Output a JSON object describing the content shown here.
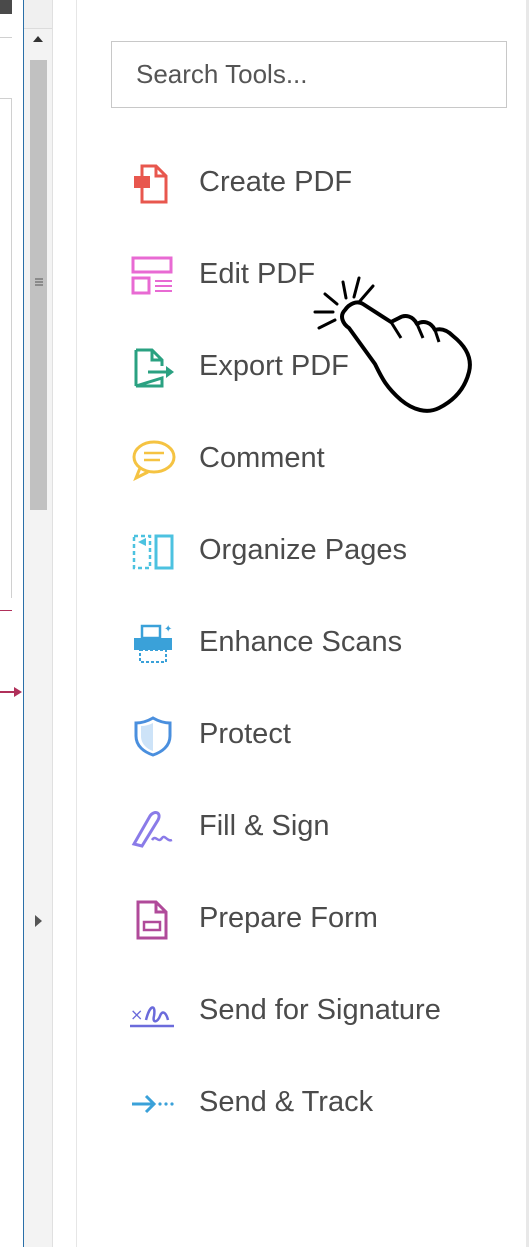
{
  "search": {
    "placeholder": "Search Tools..."
  },
  "tools": [
    {
      "label": "Create PDF",
      "icon": "create-pdf-icon",
      "color": "#e8574e"
    },
    {
      "label": "Edit PDF",
      "icon": "edit-pdf-icon",
      "color": "#e86ad3"
    },
    {
      "label": "Export PDF",
      "icon": "export-pdf-icon",
      "color": "#2aa181"
    },
    {
      "label": "Comment",
      "icon": "comment-icon",
      "color": "#f5c342"
    },
    {
      "label": "Organize Pages",
      "icon": "organize-pages-icon",
      "color": "#4cc2e0"
    },
    {
      "label": "Enhance Scans",
      "icon": "enhance-scans-icon",
      "color": "#3aa1d9"
    },
    {
      "label": "Protect",
      "icon": "protect-icon",
      "color": "#4a8fde"
    },
    {
      "label": "Fill & Sign",
      "icon": "fill-sign-icon",
      "color": "#8a7be8"
    },
    {
      "label": "Prepare Form",
      "icon": "prepare-form-icon",
      "color": "#b04a9a"
    },
    {
      "label": "Send for Signature",
      "icon": "send-for-signature-icon",
      "color": "#6b6bdb"
    },
    {
      "label": "Send & Track",
      "icon": "send-track-icon",
      "color": "#3aa1d9"
    }
  ]
}
